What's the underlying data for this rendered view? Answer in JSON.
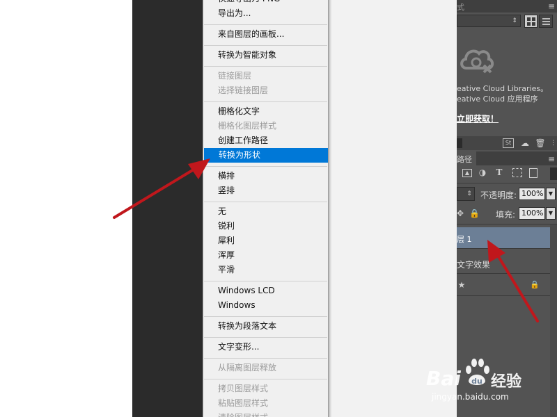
{
  "context_menu": {
    "items": [
      {
        "label": "快速导出为 PNG",
        "state": "normal",
        "partial": true
      },
      {
        "label": "导出为...",
        "state": "normal"
      },
      {
        "label": "来自图层的画板...",
        "state": "normal"
      },
      {
        "label": "转换为智能对象",
        "state": "normal"
      },
      {
        "label": "链接图层",
        "state": "disabled"
      },
      {
        "label": "选择链接图层",
        "state": "disabled"
      },
      {
        "label": "栅格化文字",
        "state": "normal"
      },
      {
        "label": "栅格化图层样式",
        "state": "disabled"
      },
      {
        "label": "创建工作路径",
        "state": "normal"
      },
      {
        "label": "转换为形状",
        "state": "selected"
      },
      {
        "label": "横排",
        "state": "normal"
      },
      {
        "label": "竖排",
        "state": "normal"
      },
      {
        "label": "无",
        "state": "normal"
      },
      {
        "label": "锐利",
        "state": "normal"
      },
      {
        "label": "犀利",
        "state": "normal"
      },
      {
        "label": "浑厚",
        "state": "normal"
      },
      {
        "label": "平滑",
        "state": "normal"
      },
      {
        "label": "Windows LCD",
        "state": "normal"
      },
      {
        "label": "Windows",
        "state": "normal"
      },
      {
        "label": "转换为段落文本",
        "state": "normal"
      },
      {
        "label": "文字变形...",
        "state": "normal"
      },
      {
        "label": "从隔离图层释放",
        "state": "disabled"
      },
      {
        "label": "拷贝图层样式",
        "state": "disabled"
      },
      {
        "label": "粘贴图层样式",
        "state": "disabled"
      },
      {
        "label": "清除图层样式",
        "state": "disabled",
        "partial": true
      }
    ]
  },
  "libraries_panel": {
    "tab_partial": "式",
    "cc_line1": "eative Cloud Libraries。",
    "cc_line2": "eative Cloud 应用程序",
    "get_link": "立即获取！"
  },
  "layers_panel": {
    "tab_partial": "路径",
    "opacity_label": "不透明度:",
    "opacity_value": "100%",
    "fill_label": "填充:",
    "fill_value": "100%",
    "layers": [
      {
        "name": "层 1",
        "selected": true
      },
      {
        "name": "文字效果",
        "selected": false
      },
      {
        "name": "",
        "selected": false
      }
    ]
  },
  "watermark": {
    "brand": "Bai",
    "brand_after": "经验",
    "url": "jingyan.baidu.com"
  },
  "colors": {
    "selected_menu": "#0078d7",
    "panel_bg": "#535353",
    "arrow": "#c0171c"
  }
}
